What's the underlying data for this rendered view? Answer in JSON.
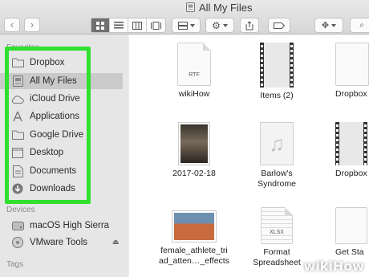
{
  "window": {
    "title": "All My Files"
  },
  "toolbar": {
    "back_icon": "‹",
    "forward_icon": "›"
  },
  "sidebar": {
    "favorites_heading": "Favorites",
    "favorites": [
      {
        "label": "Dropbox",
        "icon": "folder-icon"
      },
      {
        "label": "All My Files",
        "icon": "all-files-icon"
      },
      {
        "label": "iCloud Drive",
        "icon": "cloud-icon"
      },
      {
        "label": "Applications",
        "icon": "applications-icon"
      },
      {
        "label": "Google Drive",
        "icon": "folder-icon"
      },
      {
        "label": "Desktop",
        "icon": "desktop-icon"
      },
      {
        "label": "Documents",
        "icon": "documents-icon"
      },
      {
        "label": "Downloads",
        "icon": "downloads-icon"
      }
    ],
    "devices_heading": "Devices",
    "devices": [
      {
        "label": "macOS High Sierra",
        "icon": "disk-icon"
      },
      {
        "label": "VMware Tools",
        "icon": "disk-icon"
      }
    ],
    "tags_heading": "Tags"
  },
  "files": [
    {
      "name": "wikiHow",
      "kind": "rtf",
      "badge": "RTF"
    },
    {
      "name": "Items (2)",
      "kind": "film"
    },
    {
      "name": "Dropbox",
      "kind": "doc-partial"
    },
    {
      "name": "2017-02-18",
      "kind": "photo"
    },
    {
      "name": "Barlow's\nSyndrome",
      "kind": "music"
    },
    {
      "name": "Dropbox",
      "kind": "doc-partial"
    },
    {
      "name": "female_athlete_tri\nad_atten…_effects",
      "kind": "image"
    },
    {
      "name": "Format\nSpreadsheet",
      "kind": "xlsx",
      "badge": "XLSX"
    },
    {
      "name": "Get Sta",
      "kind": "doc-partial"
    }
  ],
  "watermark": "wikiHow",
  "colors": {
    "highlight": "#2fe02f",
    "selected_row": "#cacaca"
  }
}
